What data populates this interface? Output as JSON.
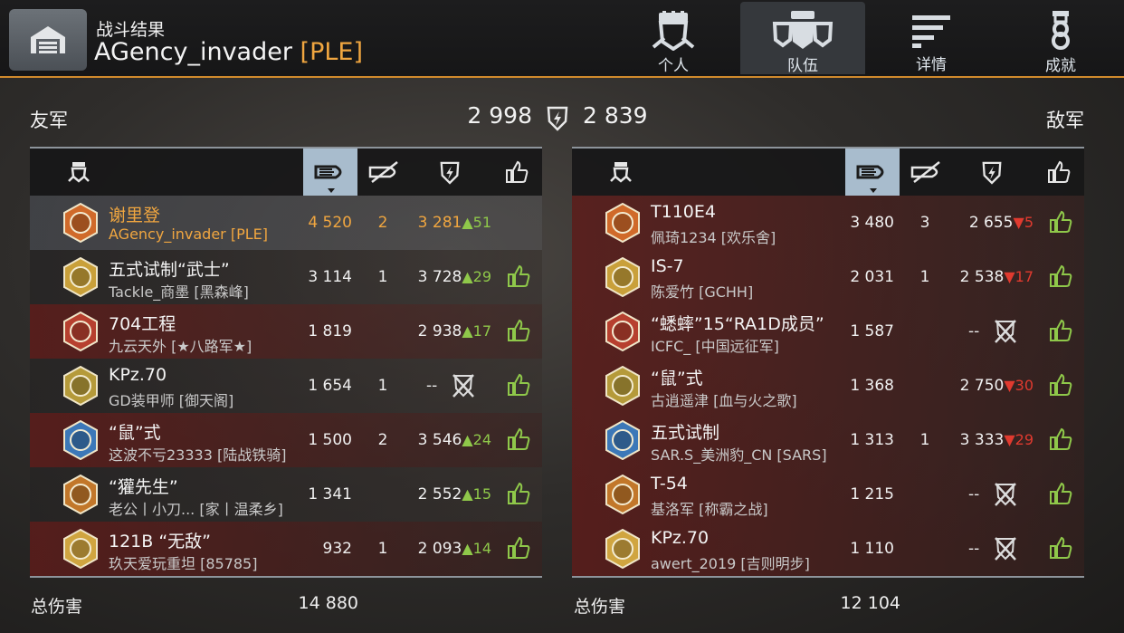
{
  "header": {
    "subtitle": "战斗结果",
    "player": "AGency_invader",
    "clan": "[PLE]",
    "tabs": [
      {
        "label": "个人",
        "icon": "soldier-icon"
      },
      {
        "label": "队伍",
        "icon": "team-icon",
        "active": true
      },
      {
        "label": "详情",
        "icon": "list-icon"
      },
      {
        "label": "成就",
        "icon": "medal-icon"
      }
    ]
  },
  "scoreboard": {
    "ally_label": "友军",
    "enemy_label": "敌军",
    "ally_score": "2 998",
    "enemy_score": "2 839"
  },
  "allies": [
    {
      "name": "谢里登",
      "clan": "AGency_invader [PLE]",
      "damage": "4 520",
      "kills": "2",
      "rating": "3 281",
      "delta": "51",
      "trend": "up",
      "me": true
    },
    {
      "name": "五式试制“武士”",
      "clan": "Tackle_商墨 [黑森峰]",
      "damage": "3 114",
      "kills": "1",
      "rating": "3 728",
      "delta": "29",
      "trend": "up"
    },
    {
      "name": "704工程",
      "clan": "九云天外 [★八路军★]",
      "damage": "1 819",
      "kills": "",
      "rating": "2 938",
      "delta": "17",
      "trend": "up"
    },
    {
      "name": "KPz.70",
      "clan": "GD装甲师 [御天阁]",
      "damage": "1 654",
      "kills": "1",
      "rating": "--",
      "delta": "",
      "trend": "dead"
    },
    {
      "name": "“鼠”式",
      "clan": "这波不亏23333 [陆战铁骑]",
      "damage": "1 500",
      "kills": "2",
      "rating": "3 546",
      "delta": "24",
      "trend": "up"
    },
    {
      "name": "“獾先生”",
      "clan": "老公丨小刀...   [家丨温柔乡]",
      "damage": "1 341",
      "kills": "",
      "rating": "2 552",
      "delta": "15",
      "trend": "up"
    },
    {
      "name": "121B “无敌”",
      "clan": "玖天爱玩重坦 [85785]",
      "damage": "932",
      "kills": "1",
      "rating": "2 093",
      "delta": "14",
      "trend": "up"
    }
  ],
  "enemies": [
    {
      "name": "T110E4",
      "clan": "佩琦1234 [欢乐舍]",
      "damage": "3 480",
      "kills": "3",
      "rating": "2 655",
      "delta": "5",
      "trend": "down"
    },
    {
      "name": "IS-7",
      "clan": "陈爱竹 [GCHH]",
      "damage": "2 031",
      "kills": "1",
      "rating": "2 538",
      "delta": "17",
      "trend": "down"
    },
    {
      "name": "“蟋蟀”15“RA1D成员”",
      "clan": "ICFC_ [中国远征军]",
      "damage": "1 587",
      "kills": "",
      "rating": "--",
      "delta": "",
      "trend": "dead"
    },
    {
      "name": "“鼠”式",
      "clan": "古逍遥津 [血与火之歌]",
      "damage": "1 368",
      "kills": "",
      "rating": "2 750",
      "delta": "30",
      "trend": "down"
    },
    {
      "name": "五式试制",
      "clan": "SAR.S_美洲豹_CN [SARS]",
      "damage": "1 313",
      "kills": "1",
      "rating": "3 333",
      "delta": "29",
      "trend": "down"
    },
    {
      "name": "T-54",
      "clan": "基洛军 [称霸之战]",
      "damage": "1 215",
      "kills": "",
      "rating": "--",
      "delta": "",
      "trend": "dead"
    },
    {
      "name": "KPz.70",
      "clan": "awert_2019 [吉则明步]",
      "damage": "1 110",
      "kills": "",
      "rating": "--",
      "delta": "",
      "trend": "dead"
    }
  ],
  "totals": {
    "label": "总伤害",
    "ally": "14 880",
    "enemy": "12 104"
  },
  "colors": {
    "accent": "#d08a2c",
    "highlight": "#f0a640",
    "up": "#8fc84a",
    "down": "#e03a2f",
    "sorted_header": "#a8bccd"
  }
}
